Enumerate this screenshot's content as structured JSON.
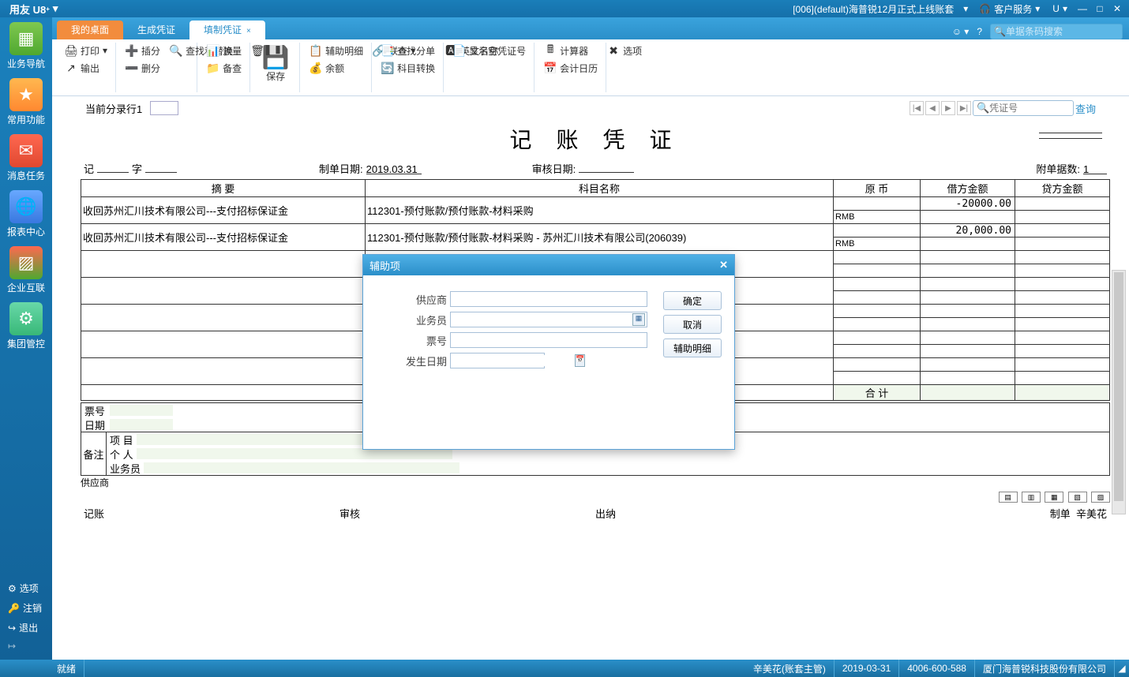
{
  "titlebar": {
    "app_name": "用友 U8",
    "account_title": "[006](default)海普锐12月正式上线账套",
    "service_label": "客户服务",
    "u_label": "U"
  },
  "sidebar": {
    "items": [
      {
        "label": "业务导航"
      },
      {
        "label": "常用功能"
      },
      {
        "label": "消息任务"
      },
      {
        "label": "报表中心"
      },
      {
        "label": "企业互联"
      },
      {
        "label": "集团管控"
      }
    ],
    "bottom": [
      {
        "label": "选项"
      },
      {
        "label": "注销"
      },
      {
        "label": "退出"
      }
    ]
  },
  "tabs": {
    "items": [
      {
        "label": "我的桌面"
      },
      {
        "label": "生成凭证"
      },
      {
        "label": "填制凭证"
      }
    ],
    "search_placeholder": "单据条码搜索"
  },
  "ribbon": {
    "g1": [
      {
        "label": "打印"
      },
      {
        "label": "输出"
      }
    ],
    "g2": [
      {
        "label": "插分"
      },
      {
        "label": "删分"
      },
      {
        "label": "查找和替换"
      }
    ],
    "g3": [
      {
        "label": "流量"
      },
      {
        "label": "备查"
      },
      {
        "label": "放弃"
      }
    ],
    "save": "保存",
    "g4": [
      {
        "label": "辅助明细"
      },
      {
        "label": "余额"
      },
      {
        "label": "联查"
      }
    ],
    "g5": [
      {
        "label": "查找分单"
      },
      {
        "label": "科目转换"
      },
      {
        "label": "英文名称"
      }
    ],
    "g6": [
      {
        "label": "显示空凭证号"
      }
    ],
    "g7": [
      {
        "label": "计算器"
      },
      {
        "label": "会计日历"
      },
      {
        "label": "选项"
      }
    ]
  },
  "entrybar": {
    "label": "当前分录行1",
    "value": "",
    "voucher_no_placeholder": "凭证号",
    "query": "查询"
  },
  "voucher": {
    "title": "记 账 凭 证",
    "prefix_left": "记",
    "prefix_right": "字",
    "make_date_label": "制单日期:",
    "make_date": "2019.03.31",
    "audit_date_label": "审核日期:",
    "audit_date": "",
    "attach_label": "附单据数:",
    "attach_value": "1",
    "headers": [
      "摘 要",
      "科目名称",
      "原 币",
      "借方金额",
      "贷方金额"
    ],
    "rows": [
      {
        "summary": "收回苏州汇川技术有限公司---支付招标保证金",
        "subject": "112301-预付账款/预付账款-材料采购",
        "currency": "RMB",
        "debit": "-20000.00",
        "credit": ""
      },
      {
        "summary": "收回苏州汇川技术有限公司---支付招标保证金",
        "subject": "112301-预付账款/预付账款-材料采购 - 苏州汇川技术有限公司(206039)",
        "currency": "RMB",
        "debit": "20,000.00",
        "credit": ""
      }
    ],
    "total_label": "合 计",
    "foot": {
      "bill_no_label": "票号",
      "date_label": "日期"
    },
    "remark": {
      "side": "备注",
      "project": "项 目",
      "person": "个 人",
      "salesman": "业务员",
      "supplier": "供应商"
    },
    "signatures": {
      "post": "记账",
      "audit": "审核",
      "cashier": "出纳",
      "maker_label": "制单",
      "maker_name": "辛美花"
    }
  },
  "modal": {
    "title": "辅助项",
    "fields": {
      "supplier": "供应商",
      "salesman": "业务员",
      "bill_no": "票号",
      "occur_date": "发生日期"
    },
    "buttons": {
      "ok": "确定",
      "cancel": "取消",
      "detail": "辅助明细"
    }
  },
  "statusbar": {
    "ready": "就绪",
    "user": "辛美花(账套主管)",
    "date": "2019-03-31",
    "phone": "4006-600-588",
    "company": "厦门海普锐科技股份有限公司"
  }
}
